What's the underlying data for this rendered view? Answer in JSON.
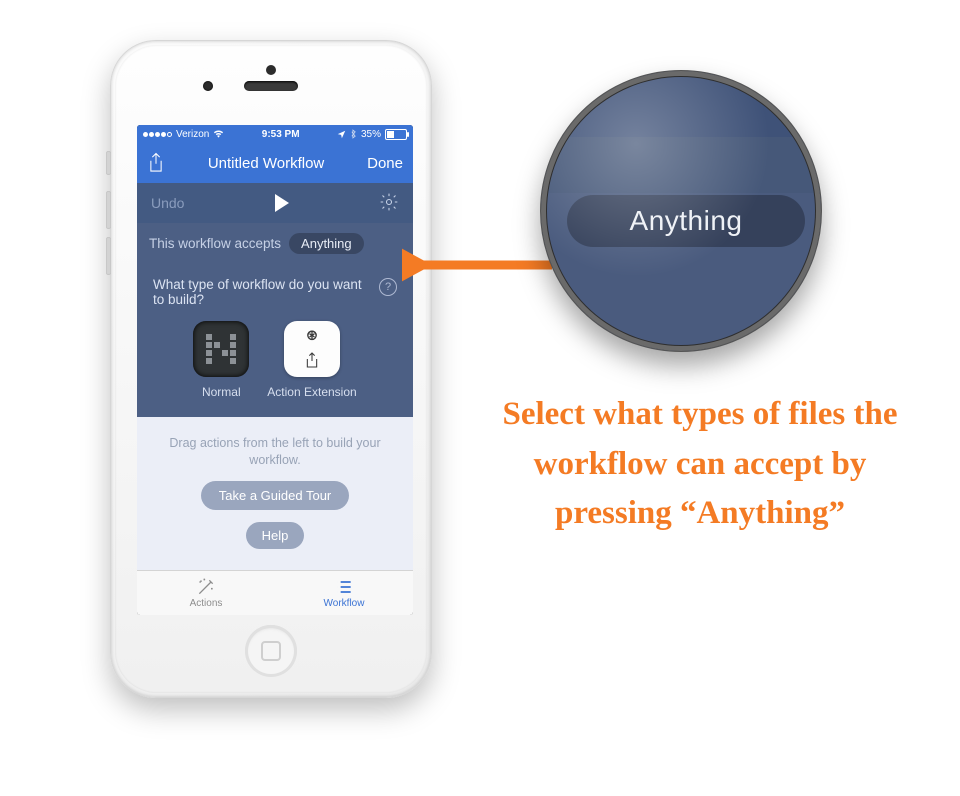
{
  "status_bar": {
    "carrier": "Verizon",
    "time": "9:53 PM",
    "battery_pct": "35%"
  },
  "nav": {
    "title": "Untitled Workflow",
    "done": "Done"
  },
  "toolbar": {
    "undo": "Undo"
  },
  "accepts": {
    "prefix": "This workflow accepts",
    "value": "Anything"
  },
  "type_panel": {
    "question": "What type of workflow do you want to build?",
    "normal_label": "Normal",
    "action_ext_label": "Action Extension"
  },
  "drag": {
    "hint": "Drag actions from the left to build your workflow.",
    "tour": "Take a Guided Tour",
    "help": "Help"
  },
  "tabs": {
    "actions": "Actions",
    "workflow": "Workflow"
  },
  "magnifier": {
    "pill": "Anything"
  },
  "caption": "Select what types of files the workflow can accept by pressing “Anything”"
}
